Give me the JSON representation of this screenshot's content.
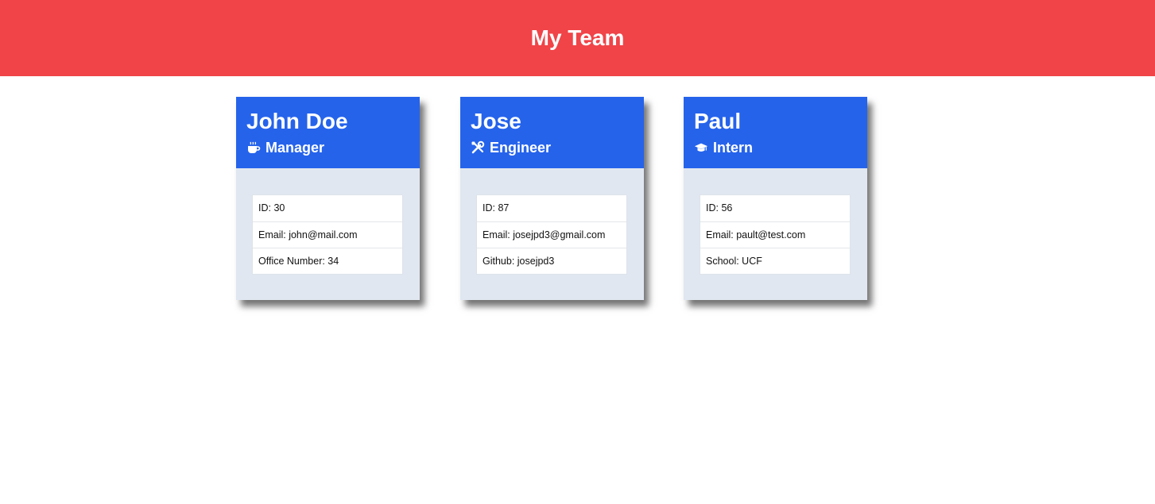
{
  "header": {
    "title": "My Team"
  },
  "colors": {
    "header_bg": "#f04448",
    "card_head_bg": "#2563eb",
    "card_body_bg": "#e0e7f0"
  },
  "cards": [
    {
      "name": "John Doe",
      "role": "Manager",
      "role_icon": "mug-icon",
      "info": [
        "ID: 30",
        "Email: john@mail.com",
        "Office Number: 34"
      ]
    },
    {
      "name": "Jose",
      "role": "Engineer",
      "role_icon": "tools-icon",
      "info": [
        "ID: 87",
        "Email: josejpd3@gmail.com",
        "Github: josejpd3"
      ]
    },
    {
      "name": "Paul",
      "role": "Intern",
      "role_icon": "graduation-cap-icon",
      "info": [
        "ID: 56",
        "Email: pault@test.com",
        "School: UCF"
      ]
    }
  ]
}
